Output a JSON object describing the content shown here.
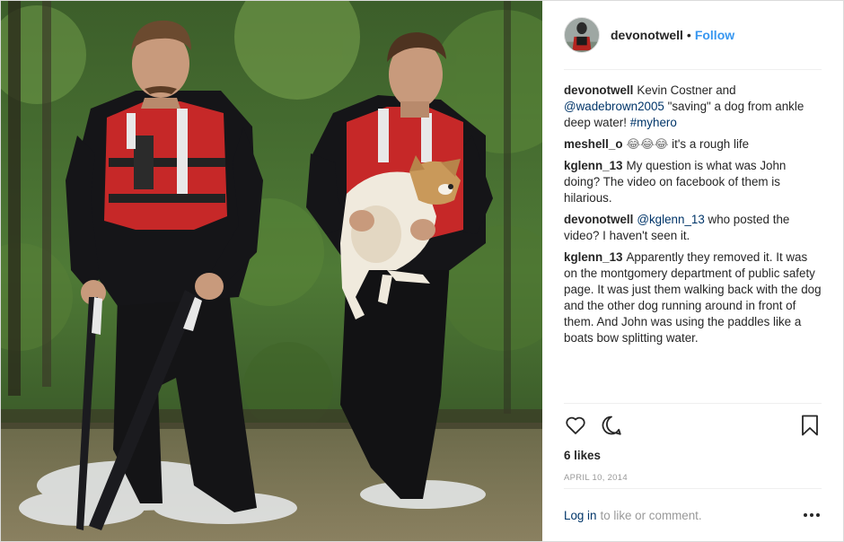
{
  "post": {
    "author": "devonotwell",
    "separator": "•",
    "follow_label": "Follow",
    "photo_icon": "photo-of-two-rescuers-carrying-dog",
    "comments": [
      {
        "user": "devonotwell",
        "parts": [
          {
            "kind": "text",
            "value": "Kevin Costner and "
          },
          {
            "kind": "mention",
            "value": "@wadebrown2005"
          },
          {
            "kind": "text",
            "value": " \"saving\" a dog from ankle deep water! "
          },
          {
            "kind": "hashtag",
            "value": "#myhero"
          }
        ]
      },
      {
        "user": "meshell_o",
        "parts": [
          {
            "kind": "emoji",
            "value": "😂😂😂"
          },
          {
            "kind": "text",
            "value": " it's a rough life"
          }
        ]
      },
      {
        "user": "kglenn_13",
        "parts": [
          {
            "kind": "text",
            "value": "My question is what was John doing? The video on facebook of them is hilarious."
          }
        ]
      },
      {
        "user": "devonotwell",
        "parts": [
          {
            "kind": "mention",
            "value": "@kglenn_13"
          },
          {
            "kind": "text",
            "value": " who posted the video? I haven't seen it."
          }
        ]
      },
      {
        "user": "kglenn_13",
        "parts": [
          {
            "kind": "text",
            "value": "Apparently they removed it. It was on the montgomery department of public safety page. It was just them walking back with the dog and the other dog running around in front of them. And John was using the paddles like a boats bow splitting water."
          }
        ]
      }
    ],
    "likes": "6 likes",
    "date": "APRIL 10, 2014",
    "login_link": "Log in",
    "login_rest": "to like or comment.",
    "colors": {
      "link": "#3897f0",
      "mention": "#003569",
      "muted": "#999999",
      "text": "#262626"
    },
    "icons": [
      "heart-icon",
      "comment-icon",
      "bookmark-icon",
      "more-options-icon"
    ]
  }
}
